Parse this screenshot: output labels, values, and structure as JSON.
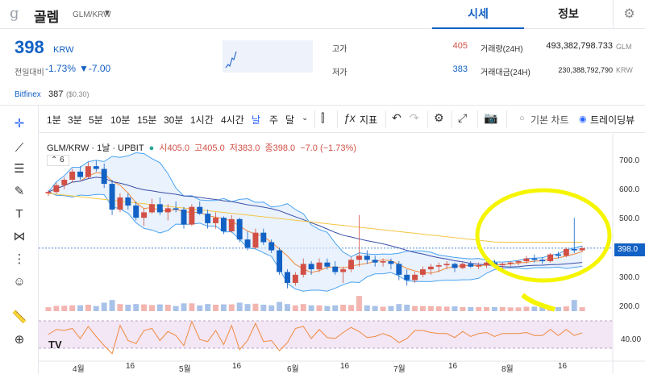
{
  "header": {
    "coin_logo": "g",
    "coin_name": "골렘",
    "pair": "GLM/KRW",
    "tabs": [
      "시세",
      "정보"
    ]
  },
  "price": {
    "current": "398",
    "unit": "KRW",
    "change_label": "전일대비",
    "change_pct": "-1.73%",
    "change_abs": "▼-7.00"
  },
  "stats": {
    "high_label": "고가",
    "high": "405",
    "low_label": "저가",
    "low": "383",
    "volume_label": "거래량(24H)",
    "volume": "493,382,798.733",
    "volume_unit": "GLM",
    "turnover_label": "거래대금(24H)",
    "turnover": "230,388,792,790",
    "turnover_unit": "KRW"
  },
  "bitfinex": {
    "label": "Bitfinex",
    "price": "387",
    "usd": "($0.30)"
  },
  "toolbar": {
    "timeframes": [
      "1분",
      "3분",
      "5분",
      "10분",
      "15분",
      "30분",
      "1시간",
      "4시간",
      "날",
      "주",
      "달"
    ],
    "active_timeframe": "날",
    "indicator_label": "지표",
    "basic_chart": "기본 차트",
    "trading_view": "트레이딩뷰"
  },
  "legend": {
    "symbol": "GLM/KRW · 1날 · UPBIT",
    "open": "시405.0",
    "high": "고405.0",
    "low": "저383.0",
    "close": "종398.0",
    "change": "−7.0 (−1.73%)",
    "indicator_count": "6"
  },
  "y_axis": [
    "700.0",
    "600.0",
    "500.0",
    "400.0",
    "300.0",
    "200.0"
  ],
  "current_price_tag": "398.0",
  "rsi_axis": "40.00",
  "x_axis": [
    "4월",
    "16",
    "5월",
    "16",
    "6월",
    "16",
    "7월",
    "16",
    "8월",
    "16"
  ],
  "colors": {
    "up": "#d24f45",
    "down": "#1261c4",
    "accent": "#1261c4",
    "highlight": "#f5f500"
  },
  "chart_data": {
    "type": "candlestick",
    "ylim": [
      160,
      760
    ],
    "candles": [
      [
        600,
        612,
        590,
        605
      ],
      [
        605,
        640,
        598,
        630
      ],
      [
        630,
        660,
        615,
        650
      ],
      [
        650,
        690,
        640,
        680
      ],
      [
        680,
        700,
        650,
        660
      ],
      [
        660,
        715,
        655,
        700
      ],
      [
        700,
        720,
        680,
        690
      ],
      [
        690,
        710,
        620,
        635
      ],
      [
        635,
        650,
        520,
        540
      ],
      [
        540,
        600,
        530,
        585
      ],
      [
        585,
        600,
        540,
        555
      ],
      [
        555,
        570,
        500,
        510
      ],
      [
        510,
        545,
        480,
        530
      ],
      [
        530,
        580,
        525,
        560
      ],
      [
        560,
        585,
        520,
        530
      ],
      [
        530,
        560,
        500,
        545
      ],
      [
        545,
        570,
        530,
        540
      ],
      [
        540,
        550,
        470,
        485
      ],
      [
        485,
        560,
        480,
        550
      ],
      [
        550,
        570,
        520,
        525
      ],
      [
        525,
        540,
        470,
        490
      ],
      [
        490,
        530,
        470,
        510
      ],
      [
        510,
        515,
        450,
        460
      ],
      [
        460,
        520,
        455,
        505
      ],
      [
        505,
        510,
        420,
        430
      ],
      [
        430,
        460,
        390,
        400
      ],
      [
        400,
        470,
        395,
        455
      ],
      [
        455,
        470,
        410,
        420
      ],
      [
        420,
        430,
        380,
        390
      ],
      [
        390,
        400,
        300,
        310
      ],
      [
        310,
        320,
        250,
        270
      ],
      [
        270,
        310,
        260,
        300
      ],
      [
        300,
        360,
        290,
        340
      ],
      [
        340,
        350,
        300,
        320
      ],
      [
        320,
        360,
        310,
        345
      ],
      [
        345,
        360,
        320,
        330
      ],
      [
        330,
        350,
        300,
        310
      ],
      [
        310,
        330,
        270,
        320
      ],
      [
        320,
        365,
        310,
        355
      ],
      [
        355,
        520,
        330,
        370
      ],
      [
        370,
        390,
        340,
        355
      ],
      [
        355,
        370,
        330,
        345
      ],
      [
        345,
        360,
        330,
        350
      ],
      [
        350,
        360,
        320,
        340
      ],
      [
        340,
        350,
        280,
        300
      ],
      [
        300,
        320,
        260,
        280
      ],
      [
        280,
        310,
        270,
        300
      ],
      [
        300,
        330,
        290,
        320
      ],
      [
        320,
        340,
        300,
        330
      ],
      [
        330,
        345,
        310,
        335
      ],
      [
        335,
        350,
        320,
        340
      ],
      [
        340,
        345,
        310,
        325
      ],
      [
        325,
        345,
        320,
        340
      ],
      [
        340,
        350,
        325,
        330
      ],
      [
        330,
        345,
        320,
        335
      ],
      [
        335,
        350,
        325,
        345
      ],
      [
        345,
        355,
        330,
        335
      ],
      [
        335,
        345,
        320,
        340
      ],
      [
        340,
        350,
        330,
        345
      ],
      [
        345,
        355,
        335,
        350
      ],
      [
        350,
        370,
        340,
        360
      ],
      [
        360,
        375,
        345,
        355
      ],
      [
        355,
        365,
        340,
        350
      ],
      [
        350,
        380,
        345,
        375
      ],
      [
        375,
        385,
        360,
        370
      ],
      [
        370,
        400,
        365,
        395
      ],
      [
        395,
        510,
        380,
        390
      ],
      [
        390,
        405,
        383,
        398
      ]
    ]
  }
}
